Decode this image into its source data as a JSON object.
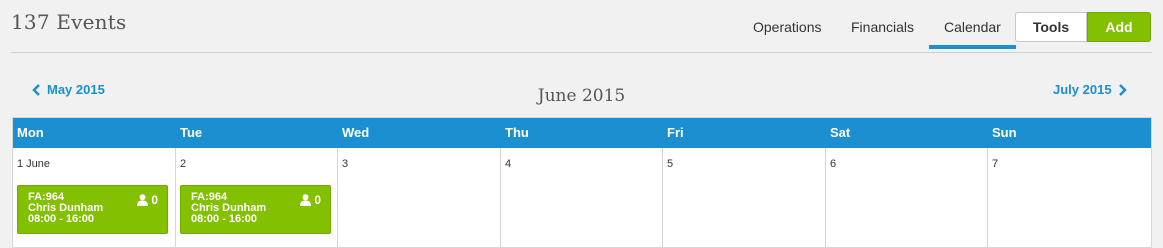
{
  "header": {
    "title": "137 Events",
    "tabs": [
      {
        "label": "Operations"
      },
      {
        "label": "Financials"
      },
      {
        "label": "Calendar",
        "active": true
      }
    ],
    "tools_label": "Tools",
    "add_label": "Add"
  },
  "calendar": {
    "prev_month": "May 2015",
    "current_month": "June 2015",
    "next_month": "July 2015",
    "day_names": [
      "Mon",
      "Tue",
      "Wed",
      "Thu",
      "Fri",
      "Sat",
      "Sun"
    ],
    "days": [
      {
        "label": "1 June"
      },
      {
        "label": "2"
      },
      {
        "label": "3"
      },
      {
        "label": "4"
      },
      {
        "label": "5"
      },
      {
        "label": "6"
      },
      {
        "label": "7"
      }
    ],
    "events": [
      {
        "code": "FA:964",
        "name": "Chris Dunham",
        "time": "08:00 - 16:00",
        "guests": "0"
      },
      {
        "code": "FA:964",
        "name": "Chris Dunham",
        "time": "08:00 - 16:00",
        "guests": "0"
      }
    ]
  },
  "colors": {
    "accent": "#1b8fd0",
    "event": "#82c000"
  },
  "icons": {
    "prev": "chevron-left-icon",
    "next": "chevron-right-icon",
    "guests": "person-icon"
  }
}
